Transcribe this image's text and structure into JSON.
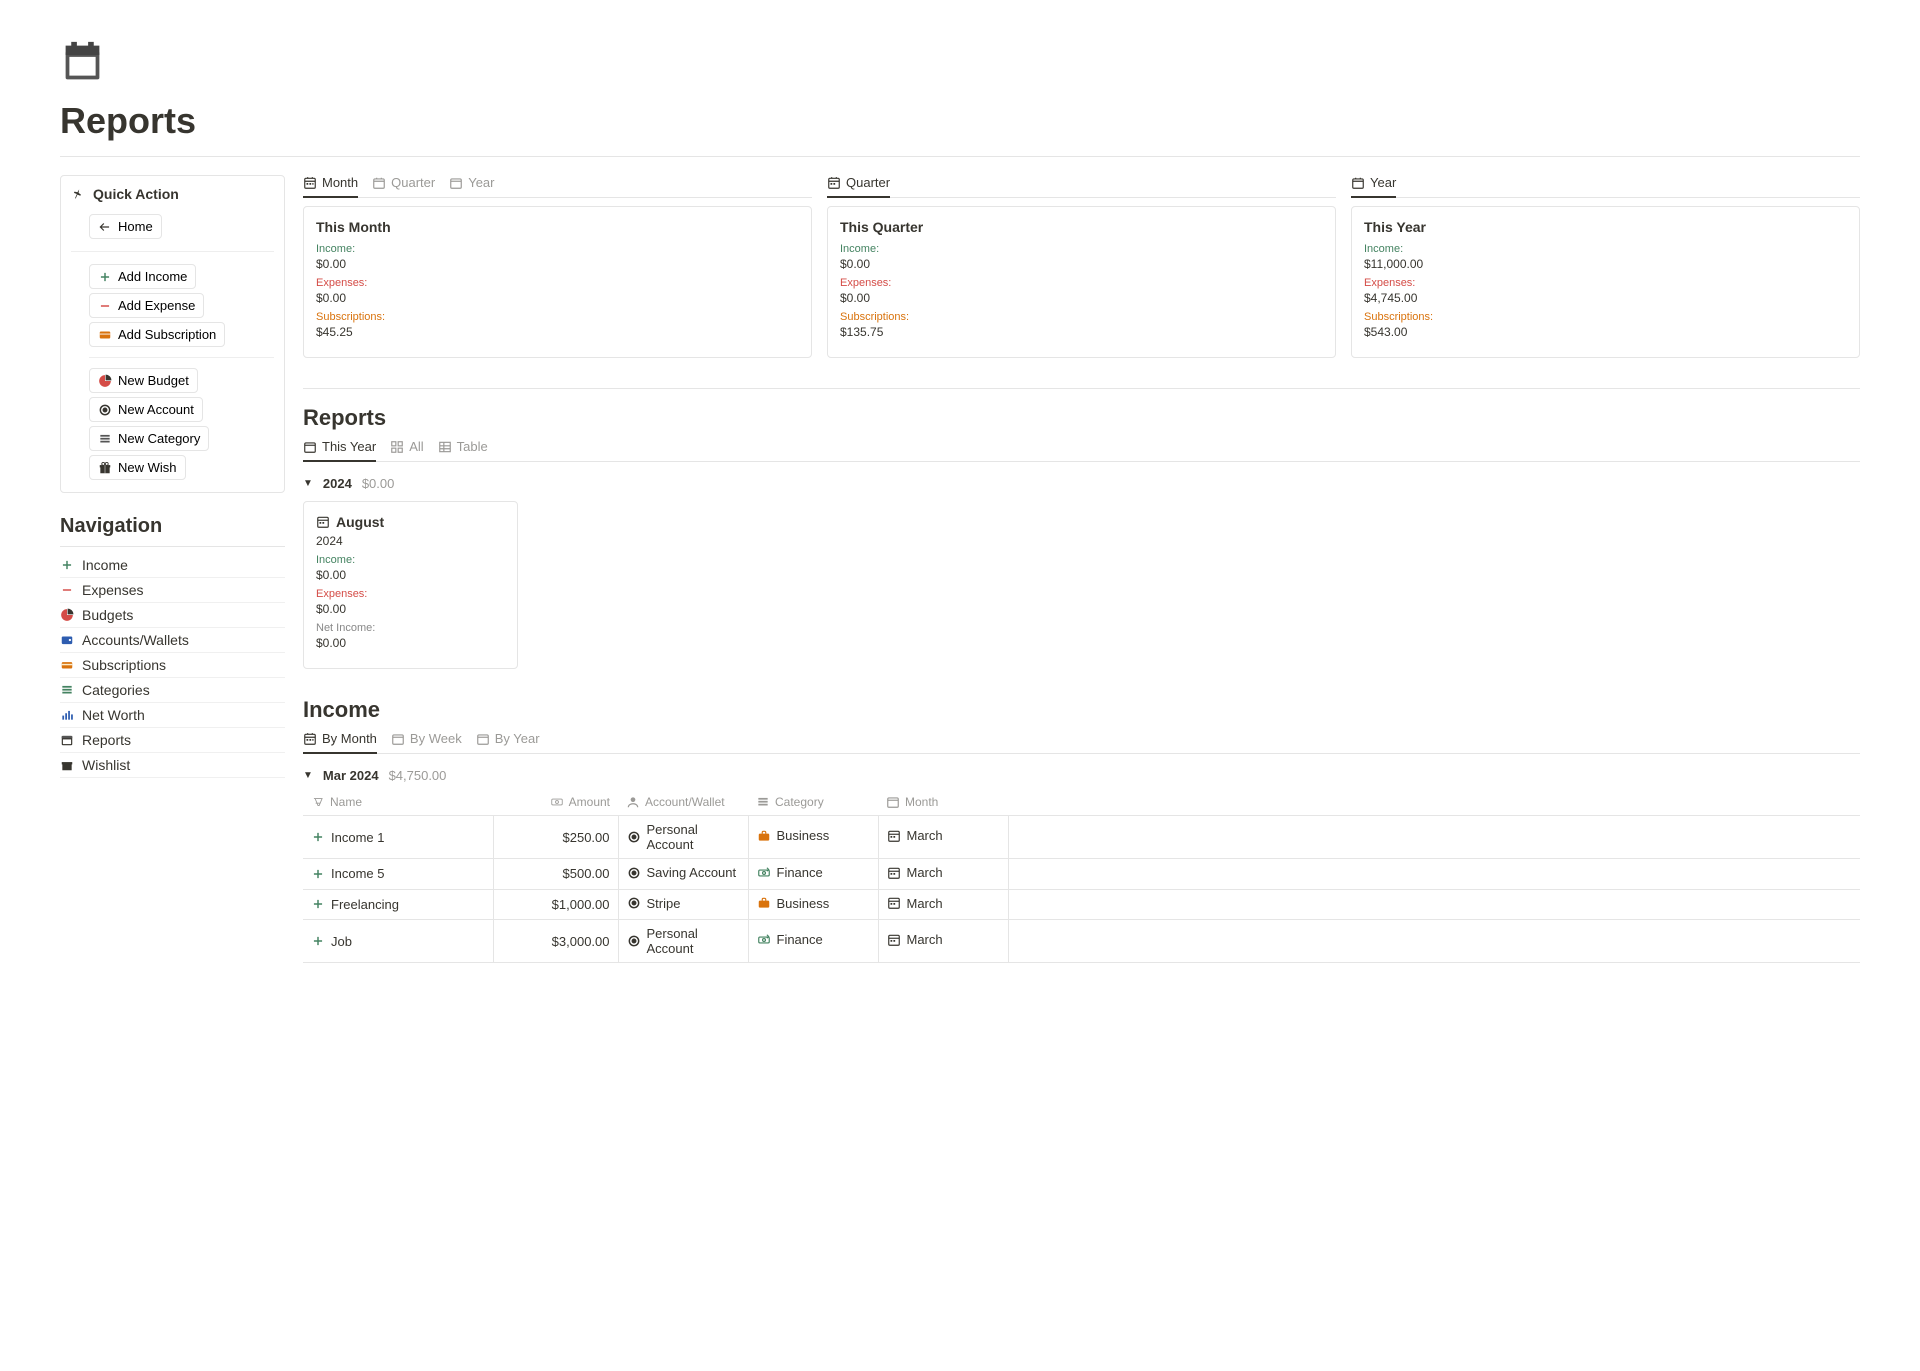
{
  "page_title": "Reports",
  "quick_action": {
    "header": "Quick Action",
    "home": "Home",
    "add_income": "Add Income",
    "add_expense": "Add Expense",
    "add_subscription": "Add Subscription",
    "new_budget": "New Budget",
    "new_account": "New Account",
    "new_category": "New Category",
    "new_wish": "New Wish"
  },
  "nav": {
    "title": "Navigation",
    "items": {
      "income": "Income",
      "expenses": "Expenses",
      "budgets": "Budgets",
      "accounts": "Accounts/Wallets",
      "subscriptions": "Subscriptions",
      "categories": "Categories",
      "networth": "Net Worth",
      "reports": "Reports",
      "wishlist": "Wishlist"
    }
  },
  "summary": {
    "month": {
      "tabs": {
        "month": "Month",
        "quarter": "Quarter",
        "year": "Year"
      },
      "card_title": "This Month",
      "income_label": "Income:",
      "income_value": "$0.00",
      "expenses_label": "Expenses:",
      "expenses_value": "$0.00",
      "subs_label": "Subscriptions:",
      "subs_value": "$45.25"
    },
    "quarter": {
      "tab": "Quarter",
      "card_title": "This Quarter",
      "income_label": "Income:",
      "income_value": "$0.00",
      "expenses_label": "Expenses:",
      "expenses_value": "$0.00",
      "subs_label": "Subscriptions:",
      "subs_value": "$135.75"
    },
    "year": {
      "tab": "Year",
      "card_title": "This Year",
      "income_label": "Income:",
      "income_value": "$11,000.00",
      "expenses_label": "Expenses:",
      "expenses_value": "$4,745.00",
      "subs_label": "Subscriptions:",
      "subs_value": "$543.00"
    }
  },
  "reports": {
    "header": "Reports",
    "tabs": {
      "this_year": "This Year",
      "all": "All",
      "table": "Table"
    },
    "group_year": "2024",
    "group_sum": "$0.00",
    "card": {
      "title": "August",
      "year": "2024",
      "income_label": "Income:",
      "income_value": "$0.00",
      "expenses_label": "Expenses:",
      "expenses_value": "$0.00",
      "net_label": "Net Income:",
      "net_value": "$0.00"
    }
  },
  "income": {
    "header": "Income",
    "tabs": {
      "by_month": "By Month",
      "by_week": "By Week",
      "by_year": "By Year"
    },
    "group_label": "Mar 2024",
    "group_sum": "$4,750.00",
    "columns": {
      "name": "Name",
      "amount": "Amount",
      "account": "Account/Wallet",
      "category": "Category",
      "month": "Month"
    },
    "rows": [
      {
        "name": "Income 1",
        "amount": "$250.00",
        "account": "Personal Account",
        "category": "Business",
        "cat_color": "#d9730d",
        "cat_icon": "briefcase",
        "month": "March"
      },
      {
        "name": "Income 5",
        "amount": "$500.00",
        "account": "Saving Account",
        "category": "Finance",
        "cat_color": "#448361",
        "cat_icon": "money",
        "month": "March"
      },
      {
        "name": "Freelancing",
        "amount": "$1,000.00",
        "account": "Stripe",
        "category": "Business",
        "cat_color": "#d9730d",
        "cat_icon": "briefcase",
        "month": "March"
      },
      {
        "name": "Job",
        "amount": "$3,000.00",
        "account": "Personal Account",
        "category": "Finance",
        "cat_color": "#448361",
        "cat_icon": "money",
        "month": "March"
      }
    ]
  }
}
